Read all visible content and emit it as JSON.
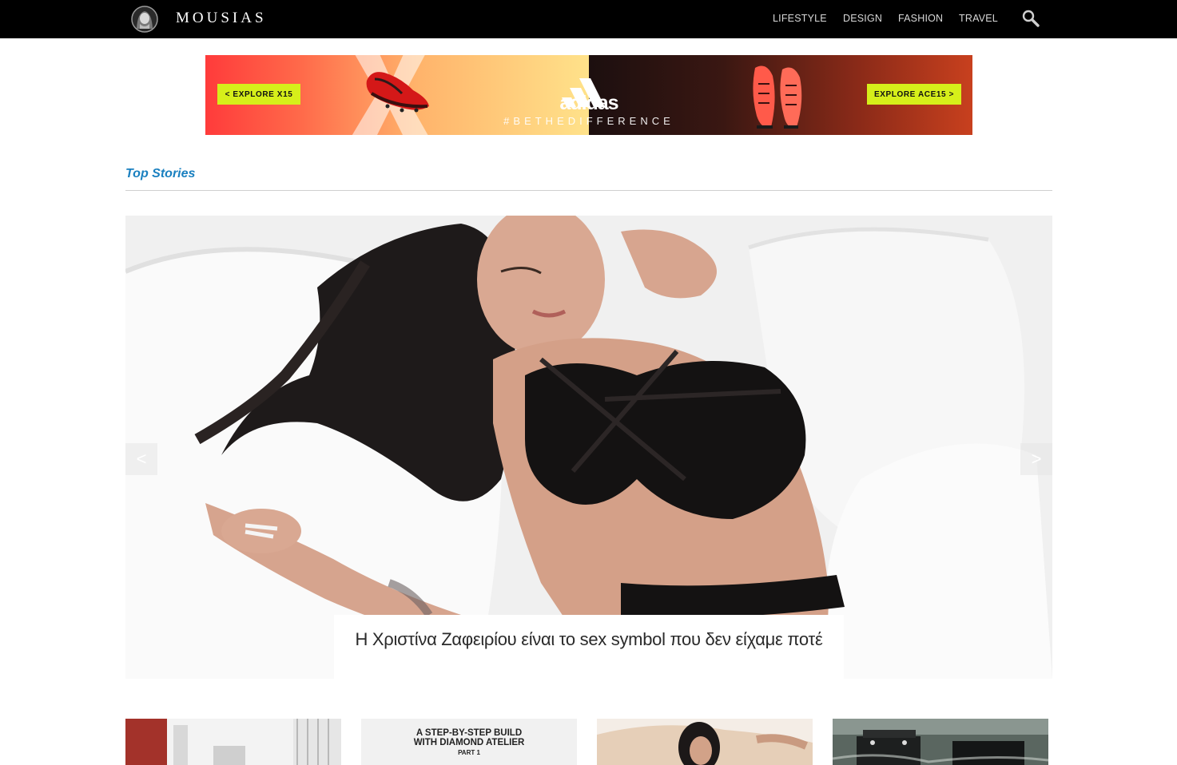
{
  "header": {
    "logo_text": "MOUSIAS",
    "nav": [
      "LIFESTYLE",
      "DESIGN",
      "FASHION",
      "TRAVEL"
    ],
    "search_icon": "search-icon"
  },
  "banner": {
    "left_button": "< EXPLORE X15",
    "brand": "adidas",
    "tagline": "#BETHEDIFFERENCE",
    "right_button": "EXPLORE ACE15 >",
    "colors": {
      "button": "#d6ef1a",
      "left_bg": "#ff3b3b",
      "right_bg": "#3a1712"
    }
  },
  "top_stories": {
    "title": "Top Stories",
    "title_color": "#1a80c0",
    "slider": {
      "prev_label": "<",
      "next_label": ">",
      "caption": "Η Χριστίνα Ζαφειρίου είναι το sex symbol που δεν είχαμε ποτέ"
    }
  },
  "thumbnails": {
    "thumb2_title_line1": "A STEP-BY-STEP BUILD",
    "thumb2_title_line2": "WITH DIAMOND ATELIER",
    "thumb2_part": "PART 1"
  }
}
